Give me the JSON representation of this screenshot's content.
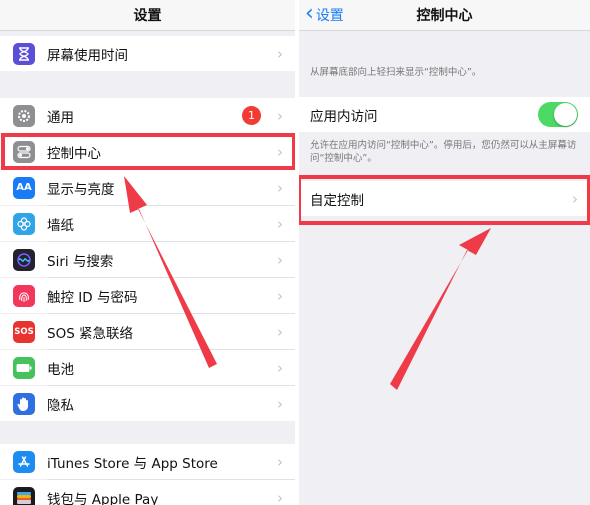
{
  "left": {
    "title": "设置",
    "rows": [
      {
        "label": "屏幕使用时间",
        "icon": "hourglass-icon",
        "color": "#5b4fd6"
      },
      {
        "label": "通用",
        "icon": "gear-icon",
        "color": "#8e8e93",
        "badge": "1"
      },
      {
        "label": "控制中心",
        "icon": "toggles-icon",
        "color": "#8e8e93"
      },
      {
        "label": "显示与亮度",
        "icon": "text-size-icon",
        "color": "#1a7cf5"
      },
      {
        "label": "墙纸",
        "icon": "flower-icon",
        "color": "#2fa4e8"
      },
      {
        "label": "Siri 与搜索",
        "icon": "siri-icon",
        "color": "#222230"
      },
      {
        "label": "触控 ID 与密码",
        "icon": "fingerprint-icon",
        "color": "#f2375b"
      },
      {
        "label": "SOS 紧急联络",
        "icon": "sos-icon",
        "color": "#e8342f"
      },
      {
        "label": "电池",
        "icon": "battery-icon",
        "color": "#43c35a"
      },
      {
        "label": "隐私",
        "icon": "hand-icon",
        "color": "#2f6fe0"
      },
      {
        "label": "iTunes Store 与 App Store",
        "icon": "app-store-icon",
        "color": "#1d8cf0"
      },
      {
        "label": "钱包与 Apple Pay",
        "icon": "wallet-icon",
        "color": "#1b1b1f"
      }
    ]
  },
  "right": {
    "back_label": "设置",
    "title": "控制中心",
    "note1": "从屏幕底部向上轻扫来显示“控制中心”。",
    "toggle_label": "应用内访问",
    "toggle_on": true,
    "note2": "允许在应用内访问“控制中心”。停用后，您仍然可以从主屏幕访问“控制中心”。",
    "customize_label": "自定控制"
  },
  "colors": {
    "accent": "#1a7cf5",
    "annotation": "#ef3a47",
    "toggle_on": "#4cd964",
    "badge": "#f23b33"
  }
}
